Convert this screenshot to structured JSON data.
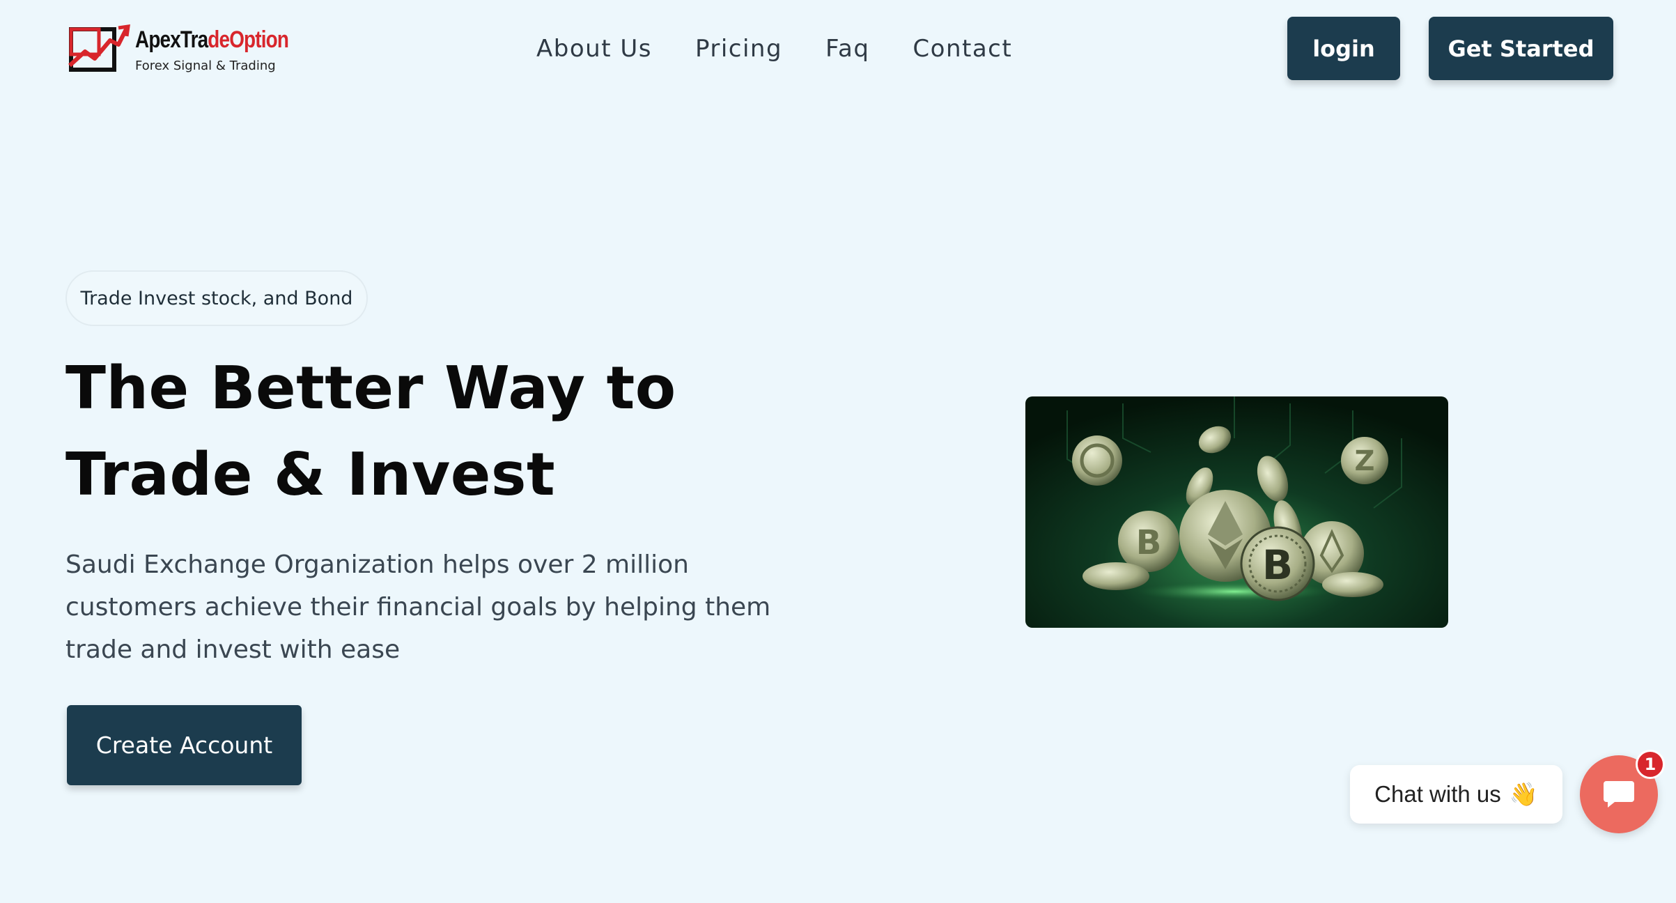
{
  "brand": {
    "name_part1": "ApexTra",
    "name_part2": "deOption",
    "tagline": "Forex Signal & Trading",
    "accent": "#d8262c"
  },
  "nav": {
    "items": [
      {
        "label": "About Us"
      },
      {
        "label": "Pricing"
      },
      {
        "label": "Faq"
      },
      {
        "label": "Contact"
      }
    ]
  },
  "header_buttons": {
    "login": "login",
    "get_started": "Get Started"
  },
  "hero": {
    "pill": "Trade Invest stock, and Bond",
    "title_line1": "The Better Way to",
    "title_line2": "Trade & Invest",
    "description": "Saudi Exchange Organization helps over 2 million customers achieve their financial goals by helping them trade and invest with ease",
    "cta": "Create Account",
    "image_icon": "crypto-coins-image"
  },
  "chat": {
    "label": "Chat with us",
    "emoji": "👋",
    "badge_count": "1",
    "icon": "chat-bubble-icon"
  },
  "colors": {
    "background": "#edf7fc",
    "button": "#1c3c4e",
    "chat": "#ec6a5f"
  }
}
